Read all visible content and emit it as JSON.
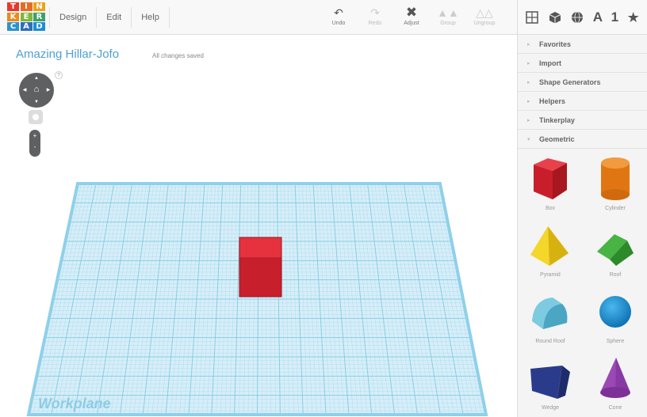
{
  "logo": {
    "letters": [
      "T",
      "I",
      "N",
      "K",
      "E",
      "R",
      "C",
      "A",
      "D"
    ]
  },
  "menu": {
    "design": "Design",
    "edit": "Edit",
    "help": "Help"
  },
  "toolbar": {
    "undo": "Undo",
    "redo": "Redo",
    "adjust": "Adjust",
    "group": "Group",
    "ungroup": "Ungroup"
  },
  "views": {
    "text_label": "A",
    "number_label": "1"
  },
  "project": {
    "title": "Amazing Hillar-Jofo",
    "save_status": "All changes saved"
  },
  "controls": {
    "help": "?",
    "zoom_in": "+",
    "zoom_out": "-"
  },
  "workplane": {
    "label": "Workplane",
    "grid_color": "#7fcbe6",
    "object_color": "#d9212e"
  },
  "sidebar": {
    "sections": [
      {
        "label": "Favorites",
        "expanded": false
      },
      {
        "label": "Import",
        "expanded": false
      },
      {
        "label": "Shape Generators",
        "expanded": false
      },
      {
        "label": "Helpers",
        "expanded": false
      },
      {
        "label": "Tinkerplay",
        "expanded": false
      },
      {
        "label": "Geometric",
        "expanded": true
      }
    ],
    "shapes": [
      {
        "label": "Box",
        "icon": "box-shape-icon",
        "color": "#d62331"
      },
      {
        "label": "Cylinder",
        "icon": "cylinder-shape-icon",
        "color": "#e8801c"
      },
      {
        "label": "Pyramid",
        "icon": "pyramid-shape-icon",
        "color": "#f2d31b"
      },
      {
        "label": "Roof",
        "icon": "roof-shape-icon",
        "color": "#3aa238"
      },
      {
        "label": "Round Roof",
        "icon": "round-roof-shape-icon",
        "color": "#5bb8cf"
      },
      {
        "label": "Sphere",
        "icon": "sphere-shape-icon",
        "color": "#1c8fd0"
      },
      {
        "label": "Wedge",
        "icon": "wedge-shape-icon",
        "color": "#2c3f8e"
      },
      {
        "label": "Cone",
        "icon": "cone-shape-icon",
        "color": "#8e3fa8"
      }
    ]
  }
}
